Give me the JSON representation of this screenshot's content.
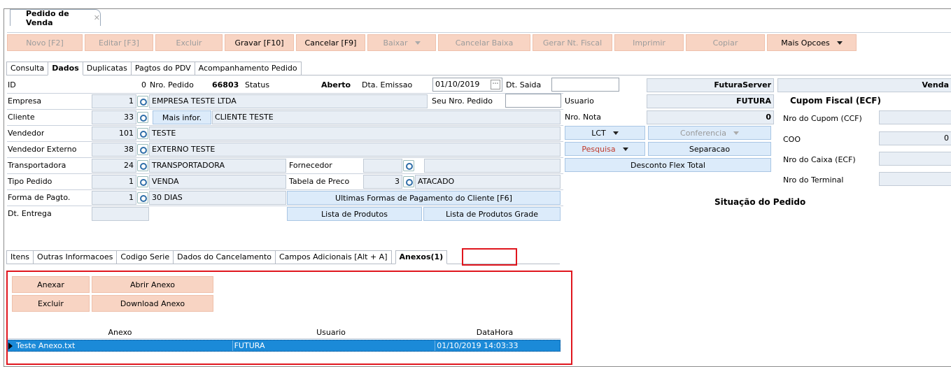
{
  "window": {
    "tab_title": "Pedido de Venda",
    "close_glyph": "✕"
  },
  "toolbar": [
    {
      "label": "Novo [F2]",
      "enabled": false
    },
    {
      "label": "Editar [F3]",
      "enabled": false
    },
    {
      "label": "Excluir",
      "enabled": false
    },
    {
      "label": "Gravar [F10]",
      "enabled": true
    },
    {
      "label": "Cancelar [F9]",
      "enabled": true
    },
    {
      "label": "Baixar",
      "enabled": false
    },
    {
      "label": "Cancelar Baixa",
      "enabled": false
    },
    {
      "label": "Gerar Nt. Fiscal",
      "enabled": false
    },
    {
      "label": "Imprimir",
      "enabled": false
    },
    {
      "label": "Copiar",
      "enabled": false
    },
    {
      "label": "Mais Opcoes",
      "enabled": true
    }
  ],
  "main_tabs": [
    "Consulta",
    "Dados",
    "Duplicatas",
    "Pagtos do PDV",
    "Acompanhamento Pedido"
  ],
  "header": {
    "id_label": "ID",
    "id_value": "0",
    "nro_pedido_label": "Nro. Pedido",
    "nro_pedido_value": "66803",
    "status_label": "Status",
    "status_value": "Aberto",
    "dta_emissao_label": "Dta. Emissao",
    "dta_emissao_value": "01/10/2019",
    "dt_saida_label": "Dt. Saida",
    "dt_saida_value": "",
    "server": "FuturaServer",
    "type": "Venda"
  },
  "fields": {
    "empresa_label": "Empresa",
    "empresa_code": "1",
    "empresa_name": "EMPRESA TESTE LTDA",
    "seu_nro_pedido_label": "Seu Nro. Pedido",
    "seu_nro_pedido_value": "",
    "usuario_label": "Usuario",
    "usuario_value": "FUTURA",
    "cliente_label": "Cliente",
    "cliente_code": "33",
    "mais_infor": "Mais infor.",
    "cliente_name": "CLIENTE TESTE",
    "nro_nota_label": "Nro. Nota",
    "nro_nota_value": "0",
    "vendedor_label": "Vendedor",
    "vendedor_code": "101",
    "vendedor_name": "TESTE",
    "vend_ext_label": "Vendedor Externo",
    "vend_ext_code": "38",
    "vend_ext_name": "EXTERNO TESTE",
    "transp_label": "Transportadora",
    "transp_code": "24",
    "transp_name": "TRANSPORTADORA",
    "fornecedor_label": "Fornecedor",
    "fornecedor_value": "",
    "tipo_label": "Tipo Pedido",
    "tipo_code": "1",
    "tipo_name": "VENDA",
    "tabela_label": "Tabela de Preco",
    "tabela_code": "3",
    "tabela_name": "ATACADO",
    "forma_label": "Forma de Pagto.",
    "forma_code": "1",
    "forma_name": "30 DIAS",
    "entrega_label": "Dt. Entrega",
    "entrega_value": ""
  },
  "buttons": {
    "lct": "LCT",
    "conferencia": "Conferencia",
    "pesquisa": "Pesquisa",
    "separacao": "Separacao",
    "desconto": "Desconto Flex Total",
    "ultimas": "Ultimas Formas de Pagamento do Cliente [F6]",
    "lista": "Lista de Produtos",
    "lista_grade": "Lista de Produtos Grade"
  },
  "cupom": {
    "title": "Cupom Fiscal (ECF)",
    "nro_cupom": "Nro do Cupom (CCF)",
    "coo": "COO",
    "coo_value": "0",
    "nro_caixa": "Nro do Caixa (ECF)",
    "nro_terminal": "Nro do Terminal"
  },
  "situacao": "Situação do Pedido",
  "sub_tabs": [
    "Itens",
    "Outras Informacoes",
    "Codigo Serie",
    "Dados do Cancelamento",
    "Campos Adicionais [Alt + A]",
    "Anexos(1)"
  ],
  "anexos": {
    "anexar": "Anexar",
    "abrir": "Abrir Anexo",
    "excluir": "Excluir",
    "download": "Download Anexo",
    "columns": [
      "Anexo",
      "Usuario",
      "DataHora"
    ],
    "rows": [
      {
        "anexo": "Teste Anexo.txt",
        "usuario": "FUTURA",
        "datahora": "01/10/2019 14:03:33"
      }
    ]
  },
  "colors": {
    "accent_button": "#f8d4c3",
    "selection": "#1b8ad8",
    "highlight_border": "#e0161e"
  }
}
